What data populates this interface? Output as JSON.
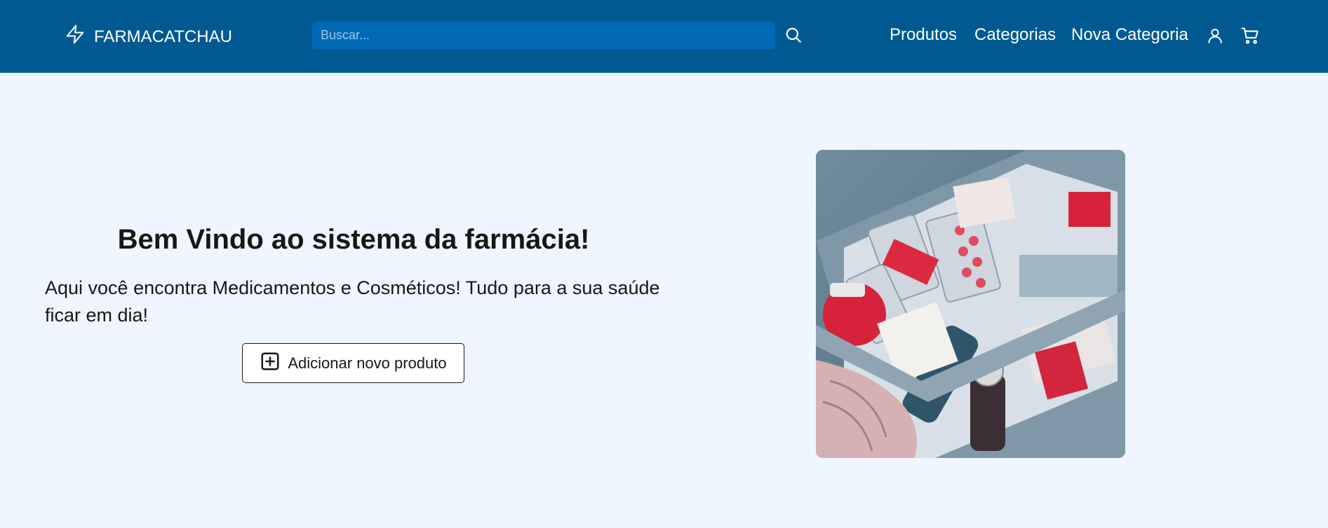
{
  "navbar": {
    "brand": "FARMACATCHAU",
    "search_placeholder": "Buscar...",
    "links": [
      "Produtos",
      "Categorias",
      "Nova Categoria"
    ],
    "icons": [
      "user-icon",
      "cart-icon"
    ],
    "bg_color": "#005a91",
    "search_bg_color": "#0069b4"
  },
  "hero": {
    "title": "Bem Vindo ao sistema da farmácia!",
    "text": "Aqui você encontra Medicamentos e Cosméticos! Tudo para a sua saúde ficar em dia!",
    "button_label": "Adicionar novo produto",
    "button_icon": "plus-square-icon",
    "image": "medicine-drawer-illustration"
  },
  "colors": {
    "page_bg": "#eff6ff"
  }
}
